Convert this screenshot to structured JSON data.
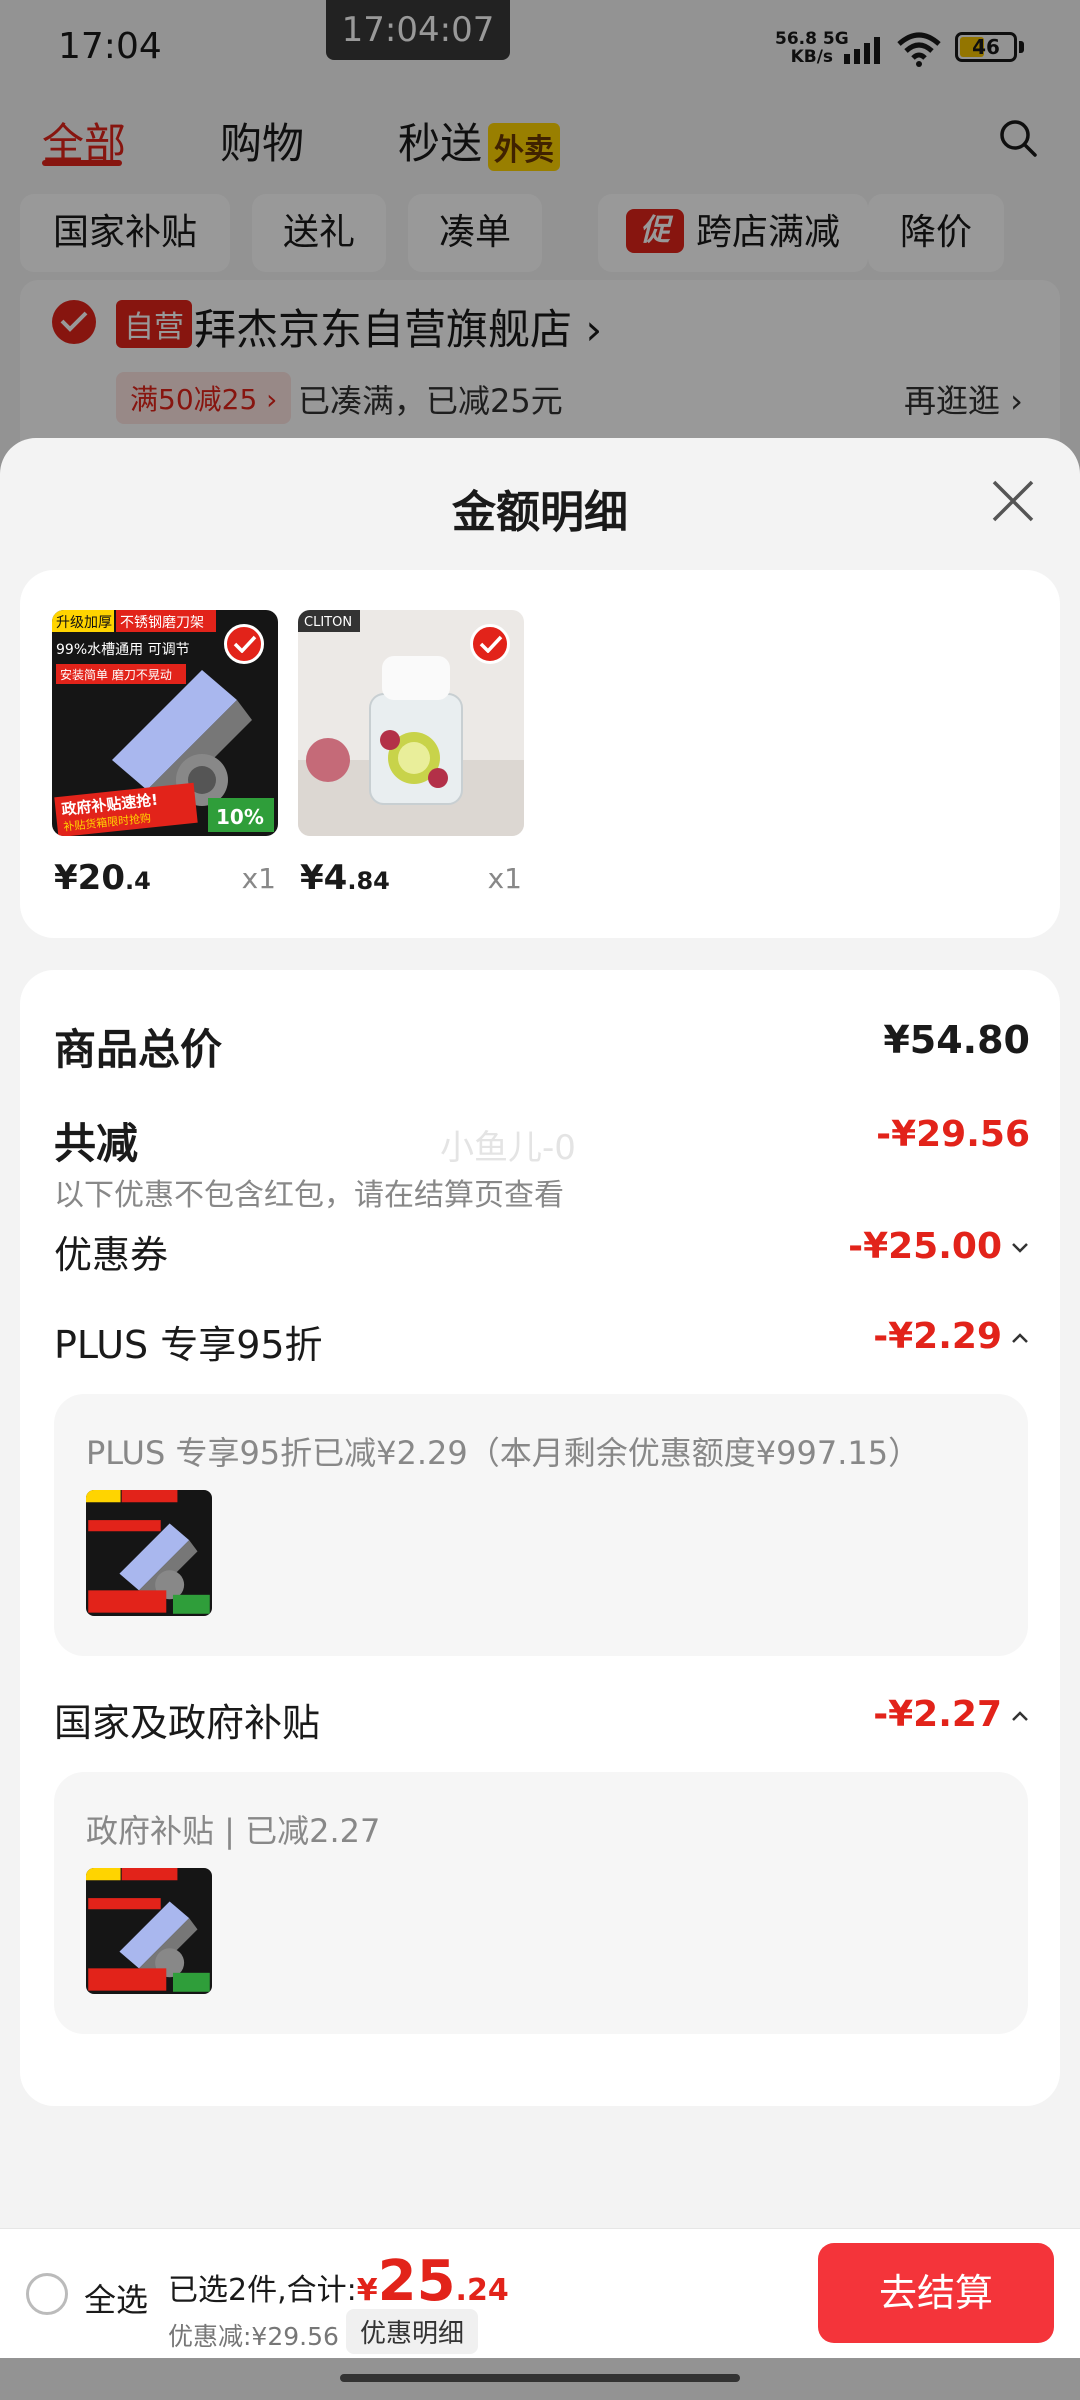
{
  "status_bar": {
    "time": "17:04",
    "center_time": "17:04:07",
    "net_speed": "56.8",
    "net_unit": "KB/s",
    "net_type": "5G",
    "battery": "46"
  },
  "top_tabs": {
    "all": "全部",
    "shopping": "购物",
    "instant": "秒送",
    "waimai_badge": "外卖"
  },
  "filter_chips": [
    "国家补贴",
    "送礼",
    "凑单",
    "跨店满减",
    "降价"
  ],
  "promo_badge": "促",
  "store": {
    "self_badge": "自营",
    "name": "拜杰京东自营旗舰店 ›",
    "coupon_tag": "满50减25 ›",
    "coupon_text": "已凑满，已减25元",
    "go_more": "再逛逛 ›"
  },
  "sheet": {
    "title": "金额明细",
    "products": [
      {
        "price_int": "¥20",
        "price_dec": ".4",
        "qty": "x1",
        "banner_top": "升级加厚",
        "banner_tag": "不锈钢磨刀架",
        "line1": "99%水槽通用 可调节",
        "line2": "安装简单 磨刀不晃动",
        "subsidy": "政府补贴速抢!",
        "subsidy_sub": "补贴货箱限时抢购",
        "percent": "10%"
      },
      {
        "price_int": "¥4",
        "price_dec": ".84",
        "qty": "x1",
        "brand": "CLITON"
      }
    ],
    "total_label": "商品总价",
    "total_value": "¥54.80",
    "reduce_label": "共减",
    "reduce_value": "-¥29.56",
    "reduce_note": "以下优惠不包含红包，请在结算页查看",
    "watermark": "小鱼儿-0",
    "coupon_label": "优惠券",
    "coupon_value": "-¥25.00",
    "plus_label": "PLUS 专享95折",
    "plus_value": "-¥2.29",
    "plus_detail": "PLUS 专享95折已减¥2.29（本月剩余优惠额度¥997.15）",
    "gov_label": "国家及政府补贴",
    "gov_value": "-¥2.27",
    "gov_detail": "政府补贴 | 已减2.27"
  },
  "footer": {
    "select_all": "全选",
    "summary_prefix": "已选2件,合计:",
    "total_symbol": "¥",
    "total_int": "25",
    "total_dec": ".24",
    "saved": "优惠减:¥29.56",
    "detail_button": "优惠明细",
    "checkout": "去结算"
  },
  "colors": {
    "accent": "#e2231a",
    "checkout_button": "#f4343a",
    "waimai_yellow": "#ffd400"
  }
}
